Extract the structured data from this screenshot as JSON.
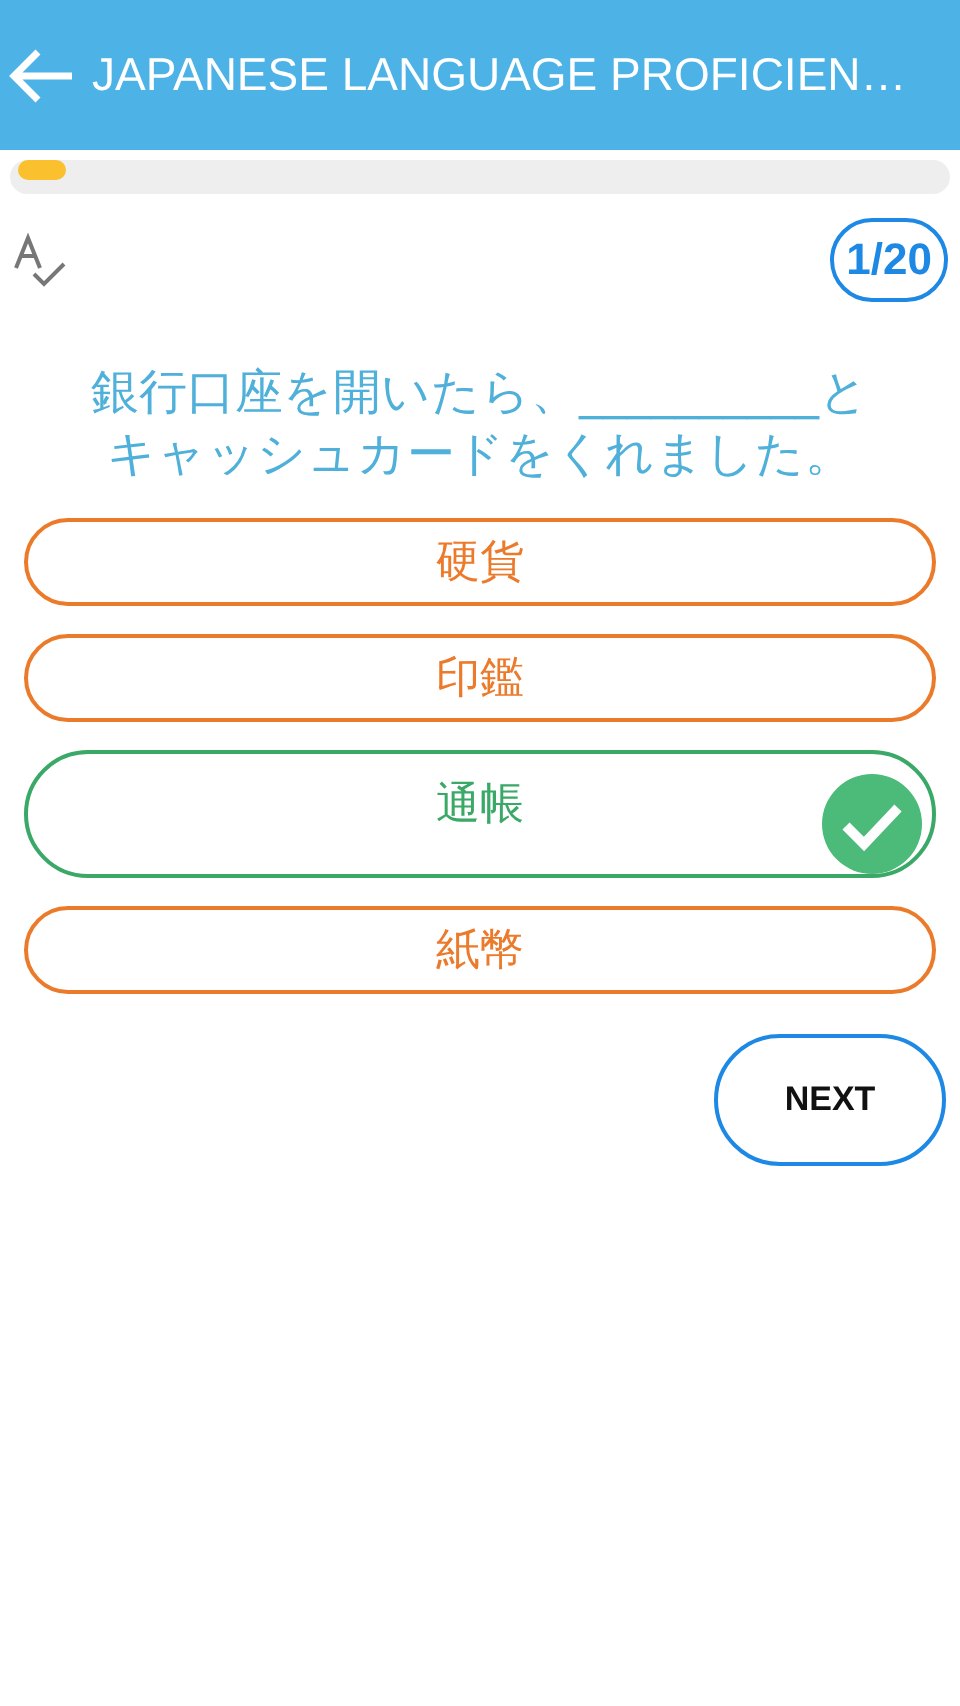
{
  "header": {
    "title": "JAPANESE LANGUAGE PROFICIEN…"
  },
  "progress": {
    "level": 0.05
  },
  "counter": "1/20",
  "question": [
    "銀行口座を開いたら、__________と",
    "キャッシュカードをくれました。"
  ],
  "options": [
    {
      "label": "硬貨",
      "correct": false
    },
    {
      "label": "印鑑",
      "correct": false
    },
    {
      "label": "通帳",
      "correct": true
    },
    {
      "label": "紙幣",
      "correct": false
    }
  ],
  "next_button": "NEXT"
}
